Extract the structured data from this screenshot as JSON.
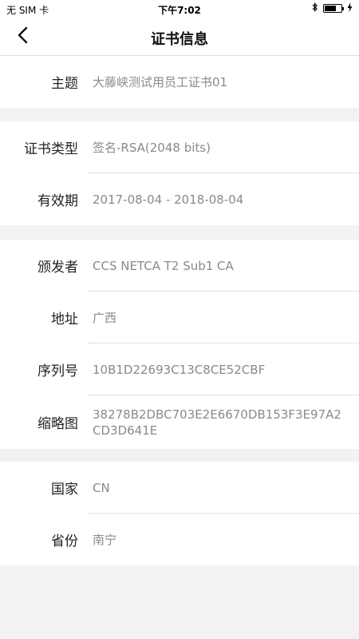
{
  "status_bar": {
    "carrier": "无 SIM 卡",
    "time": "下午7:02",
    "battery_level": 0.7
  },
  "nav": {
    "title": "证书信息"
  },
  "sections": {
    "subject": {
      "topic_label": "主题",
      "topic_value": "大藤峡测试用员工证书01"
    },
    "cert": {
      "type_label": "证书类型",
      "type_value": "签名-RSA(2048 bits)",
      "validity_label": "有效期",
      "validity_value": "2017-08-04 - 2018-08-04"
    },
    "issuer": {
      "issuer_label": "颁发者",
      "issuer_value": "CCS NETCA T2 Sub1 CA",
      "address_label": "地址",
      "address_value": "广西",
      "serial_label": "序列号",
      "serial_value": "10B1D22693C13C8CE52CBF",
      "thumbprint_label": "缩略图",
      "thumbprint_value": "38278B2DBC703E2E6670DB153F3E97A2CD3D641E"
    },
    "location": {
      "country_label": "国家",
      "country_value": "CN",
      "province_label": "省份",
      "province_value": "南宁"
    }
  }
}
